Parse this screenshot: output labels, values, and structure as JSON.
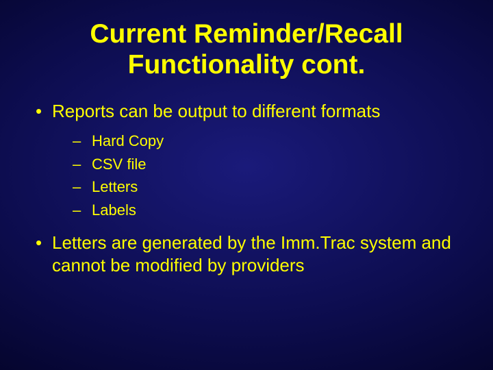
{
  "title_line1": "Current Reminder/Recall",
  "title_line2": "Functionality cont.",
  "bullet1": "Reports can be output to different formats",
  "sub": {
    "a": "Hard Copy",
    "b": "CSV file",
    "c": "Letters",
    "d": "Labels"
  },
  "bullet2": "Letters are generated by the Imm.Trac system and cannot be modified by providers"
}
